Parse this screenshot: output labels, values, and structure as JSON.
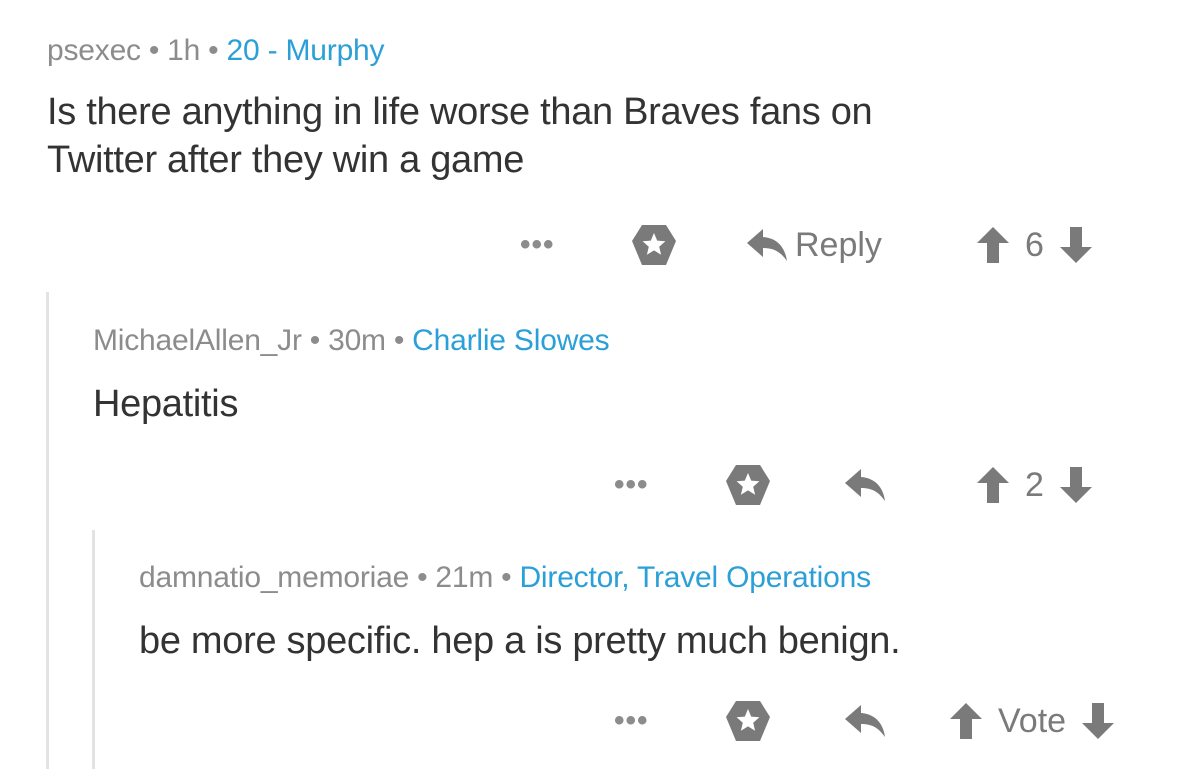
{
  "comments": [
    {
      "author": "psexec",
      "time": "1h",
      "flair": "20 - Murphy",
      "text_lines": [
        "Is there anything in life worse than Braves fans on",
        "Twitter after they win a game"
      ],
      "reply_label": "Reply",
      "score": "6",
      "more": "•••"
    },
    {
      "author": "MichaelAllen_Jr",
      "time": "30m",
      "flair": "Charlie Slowes",
      "text": "Hepatitis",
      "score": "2",
      "more": "•••"
    },
    {
      "author": "damnatio_memoriae",
      "time": "21m",
      "flair": "Director, Travel Operations",
      "text": "be more specific. hep a is pretty much benign.",
      "score": "Vote",
      "more": "•••"
    }
  ],
  "separator": "•",
  "icons": {
    "more": "more-dots-icon",
    "save": "star-badge-icon",
    "reply": "reply-arrow-icon",
    "upvote": "arrow-up-icon",
    "downvote": "arrow-down-icon"
  },
  "colors": {
    "flair": "#2b9fd8",
    "meta": "#8c8c8c",
    "text": "#333333",
    "icon": "#7a7a7a",
    "thread_line": "#e3e3e3"
  }
}
